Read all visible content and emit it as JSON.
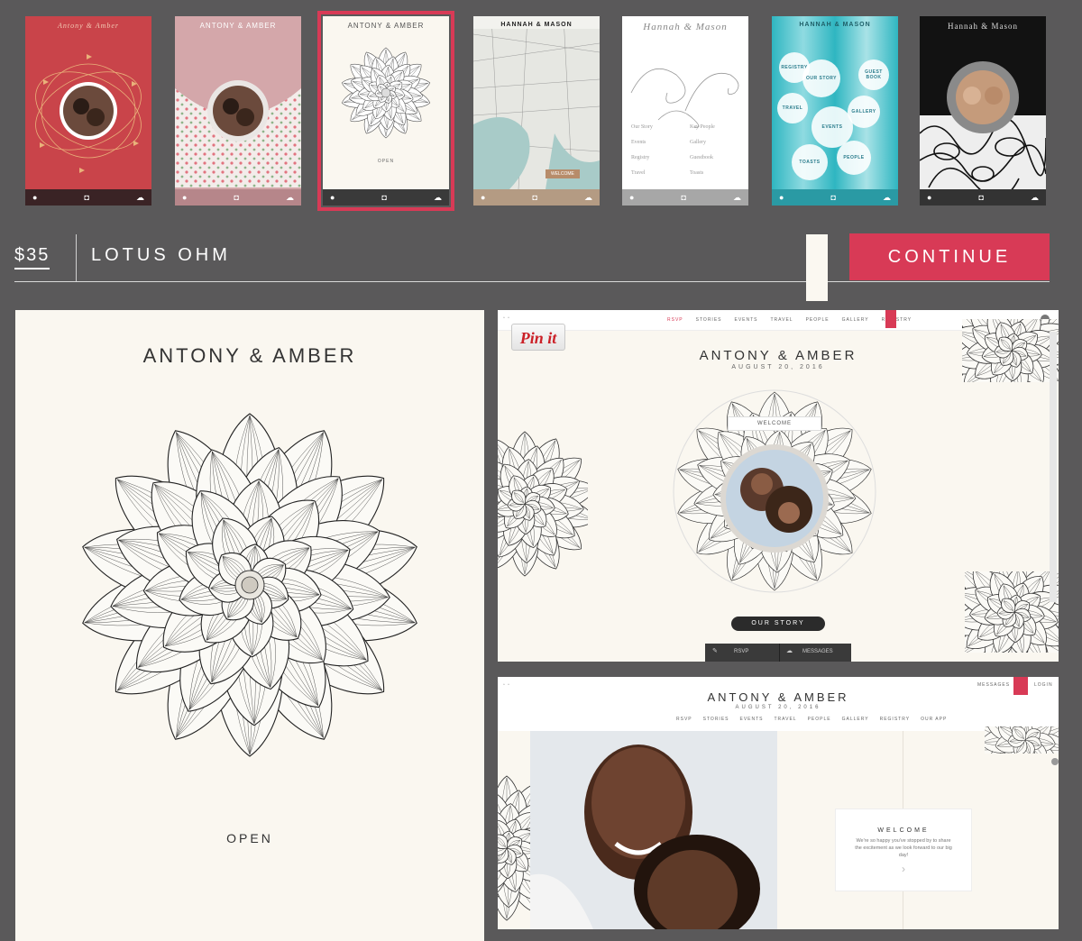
{
  "thumbnails": [
    {
      "title": "Antony & Amber",
      "bg": "#c9444a",
      "selected": false
    },
    {
      "title": "ANTONY & AMBER",
      "bg": "#d4a7aa",
      "selected": false
    },
    {
      "title": "ANTONY & AMBER",
      "bg": "#faf7f0",
      "selected": true,
      "open": "OPEN"
    },
    {
      "title": "HANNAH & MASON",
      "bg": "#dfe3dc",
      "selected": false,
      "welcome": "WELCOME"
    },
    {
      "title": "Hannah & Mason",
      "bg": "#ffffff",
      "selected": false,
      "links": [
        "Our Story",
        "Key People",
        "Events",
        "Gallery",
        "Registry",
        "Guestbook",
        "Travel",
        "Toasts"
      ]
    },
    {
      "title": "HANNAH & MASON",
      "bg": "#2fb6c1",
      "selected": false,
      "bubbles": [
        "REGISTRY",
        "GUEST BOOK",
        "OUR STORY",
        "TRAVEL",
        "GALLERY",
        "EVENTS",
        "TOASTS",
        "PEOPLE"
      ]
    },
    {
      "title": "Hannah & Mason",
      "bg": "#121212",
      "selected": false
    }
  ],
  "product": {
    "price": "$35",
    "name": "LOTUS OHM",
    "continue_label": "CONTINUE"
  },
  "mobile_preview": {
    "names": "ANTONY & AMBER",
    "open_label": "OPEN"
  },
  "web_preview_1": {
    "pinit": "Pin it",
    "nav": [
      "RSVP",
      "STORIES",
      "EVENTS",
      "TRAVEL",
      "PEOPLE",
      "GALLERY",
      "REGISTRY"
    ],
    "names": "ANTONY & AMBER",
    "date": "AUGUST 20, 2016",
    "welcome": "WELCOME",
    "our_story": "OUR STORY",
    "rsvp": "RSVP",
    "messages": "MESSAGES"
  },
  "web_preview_2": {
    "names": "ANTONY & AMBER",
    "date": "AUGUST 20, 2016",
    "nav": [
      "RSVP",
      "STORIES",
      "EVENTS",
      "TRAVEL",
      "PEOPLE",
      "GALLERY",
      "REGISTRY",
      "OUR APP"
    ],
    "messages": "MESSAGES",
    "login": "LOGIN",
    "welcome_title": "WELCOME",
    "welcome_text": "We're so happy you've stopped by to share the excitement as we look forward to our big day!"
  },
  "colors": {
    "accent": "#d83a56",
    "background": "#5a595a",
    "cream": "#faf7f0"
  }
}
